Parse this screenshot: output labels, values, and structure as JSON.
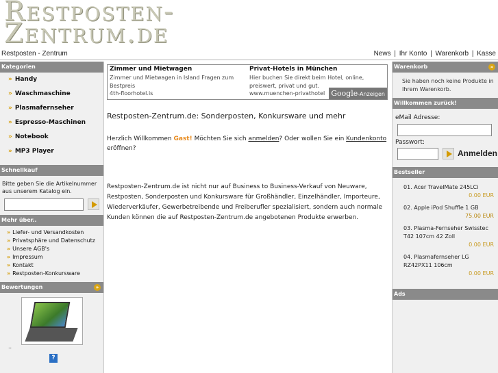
{
  "logo": {
    "line1": "Restposten-",
    "line2": "Zentrum.de"
  },
  "topbar": {
    "breadcrumb": "Restposten - Zentrum",
    "links": [
      "News",
      "Ihr Konto",
      "Warenkorb",
      "Kasse"
    ]
  },
  "left": {
    "categories_title": "Kategorien",
    "categories": [
      "Handy",
      "Waschmaschine",
      "Plasmafernseher",
      "Espresso-Maschinen",
      "Notebook",
      "MP3 Player"
    ],
    "quickbuy_title": "Schnellkauf",
    "quickbuy_text": "Bitte geben Sie die Artikelnummer aus unserem Katalog ein.",
    "more_title": "Mehr über..",
    "more_items": [
      "Liefer- und Versandkosten",
      "Privatsphäre und Datenschutz",
      "Unsere AGB's",
      "Impressum",
      "Kontakt",
      "Restposten-Konkursware"
    ],
    "reviews_title": "Bewertungen",
    "reviews_dots": "..",
    "help_icon": "?"
  },
  "ads": [
    {
      "title": "Zimmer und Mietwagen",
      "desc": "Zimmer und Mietwagen in Island Fragen zum Bestpreis",
      "url": "4th-floorhotel.is"
    },
    {
      "title": "Privat-Hotels in München",
      "desc": "Hier buchen Sie direkt beim Hotel, online, preiswert, privat und gut.",
      "url": "www.muenchen-privathotel"
    }
  ],
  "adsbadge": {
    "brand": "Google",
    "label": "-Anzeigen"
  },
  "main": {
    "title": "Restposten-Zentrum.de: Sonderposten, Konkursware und mehr",
    "welcome_pre": "Herzlich Willkommen ",
    "guest": "Gast!",
    "welcome_mid": " Möchten Sie sich ",
    "login_link": "anmelden",
    "welcome_mid2": "? Oder wollen Sie ein ",
    "account_link": "Kundenkonto",
    "welcome_post": " eröffnen?",
    "info": "Restposten-Zentrum.de ist nicht nur auf Business to Business-Verkauf von Neuware, Restposten, Sonderposten und Konkursware für Großhändler, Einzelhändler, Importeure, Wiederverkäufer, Gewerbetreibende und Freiberufler spezialisiert, sondern auch normale Kunden können die auf Restposten-Zentrum.de angebotenen Produkte erwerben."
  },
  "right": {
    "cart_title": "Warenkorb",
    "cart_text": "Sie haben noch keine Produkte in Ihrem Warenkorb.",
    "welcome_title": "Willkommen zurück!",
    "email_label": "eMail Adresse:",
    "password_label": "Passwort:",
    "login_button": "Anmelden",
    "best_title": "Bestseller",
    "bestsellers": [
      {
        "rank": "01.",
        "name": "Acer TravelMate 245LCi",
        "price": "0.00 EUR"
      },
      {
        "rank": "02.",
        "name": "Apple iPod Shuffle 1 GB",
        "price": "75.00 EUR"
      },
      {
        "rank": "03.",
        "name": "Plasma-Fernseher Swisstec T42 107cm 42 Zoll",
        "price": "0.00 EUR"
      },
      {
        "rank": "04.",
        "name": "Plasmafernseher LG RZ42PX11 106cm",
        "price": "0.00 EUR"
      }
    ],
    "ads_title": "Ads"
  },
  "colors": {
    "accent": "#d49a00",
    "header_bg": "#8a8a8a",
    "guest": "#e88b1f",
    "price": "#c89a20"
  }
}
